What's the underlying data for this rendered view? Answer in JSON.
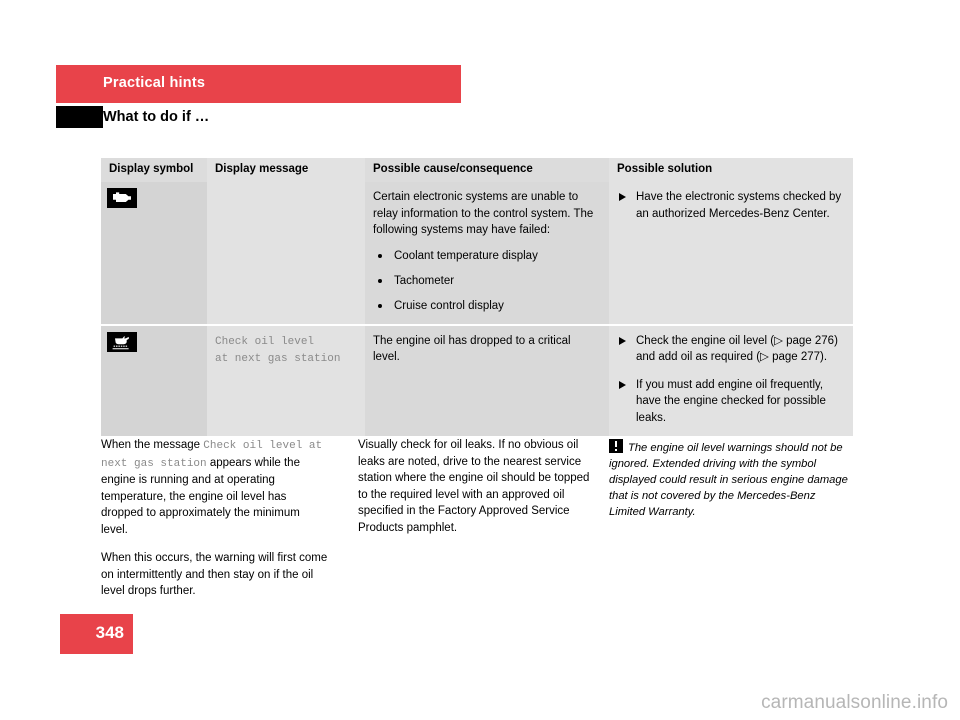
{
  "header": {
    "chapter_title": "Practical hints",
    "section_title": "What to do if …"
  },
  "table": {
    "columns": [
      "Display symbol",
      "Display message",
      "Possible cause/consequence",
      "Possible solution"
    ],
    "rows": [
      {
        "symbol_icon": "check-engine-icon",
        "display_message": "",
        "cause_intro": "Certain electronic systems are unable to relay information to the control system. The following systems may have failed:",
        "cause_items": [
          "Coolant temperature display",
          "Tachometer",
          "Cruise control display"
        ],
        "solutions": [
          "Have the electronic systems checked by an authorized Mercedes-Benz Center."
        ]
      },
      {
        "symbol_icon": "oil-can-icon",
        "display_message": "Check oil level\nat next gas station",
        "cause_intro": "The engine oil has dropped to a critical level.",
        "cause_items": [],
        "solutions": [
          "Check the engine oil level (▷ page 276) and add oil as required (▷ page 277).",
          "If you must add engine oil frequently, have the engine checked for possible leaks."
        ]
      }
    ]
  },
  "body": {
    "column_a": {
      "para1_part1": "When the message ",
      "para1_mono": "Check oil level at next gas station",
      "para1_part2": " appears while the engine is running and at operating temperature, the engine oil level has dropped to approximately the minimum level.",
      "para2": "When this occurs, the warning will first come on intermittently and then stay on if the oil level drops further."
    },
    "column_b": {
      "para1": "Visually check for oil leaks. If no obvious oil leaks are noted, drive to the nearest service station where the engine oil should be topped to the required level with an approved oil specified in the Factory Approved Service Products pamphlet."
    },
    "column_c": {
      "warning_icon": "warning-exclamation-icon",
      "warning_text": "The engine oil level warnings should not be ignored. Extended driving with the symbol displayed could result in serious engine damage that is not covered by the Mercedes-Benz Limited Warranty."
    }
  },
  "footer": {
    "page_number": "348",
    "watermark": "carmanualsonline.info"
  },
  "colors": {
    "accent_red": "#e8434a",
    "table_header_gray": "#dcdcdc",
    "cell_gray_dark": "#d4d4d4",
    "cell_gray_light": "#e2e2e2",
    "mono_text_gray": "#8a8a8a"
  }
}
